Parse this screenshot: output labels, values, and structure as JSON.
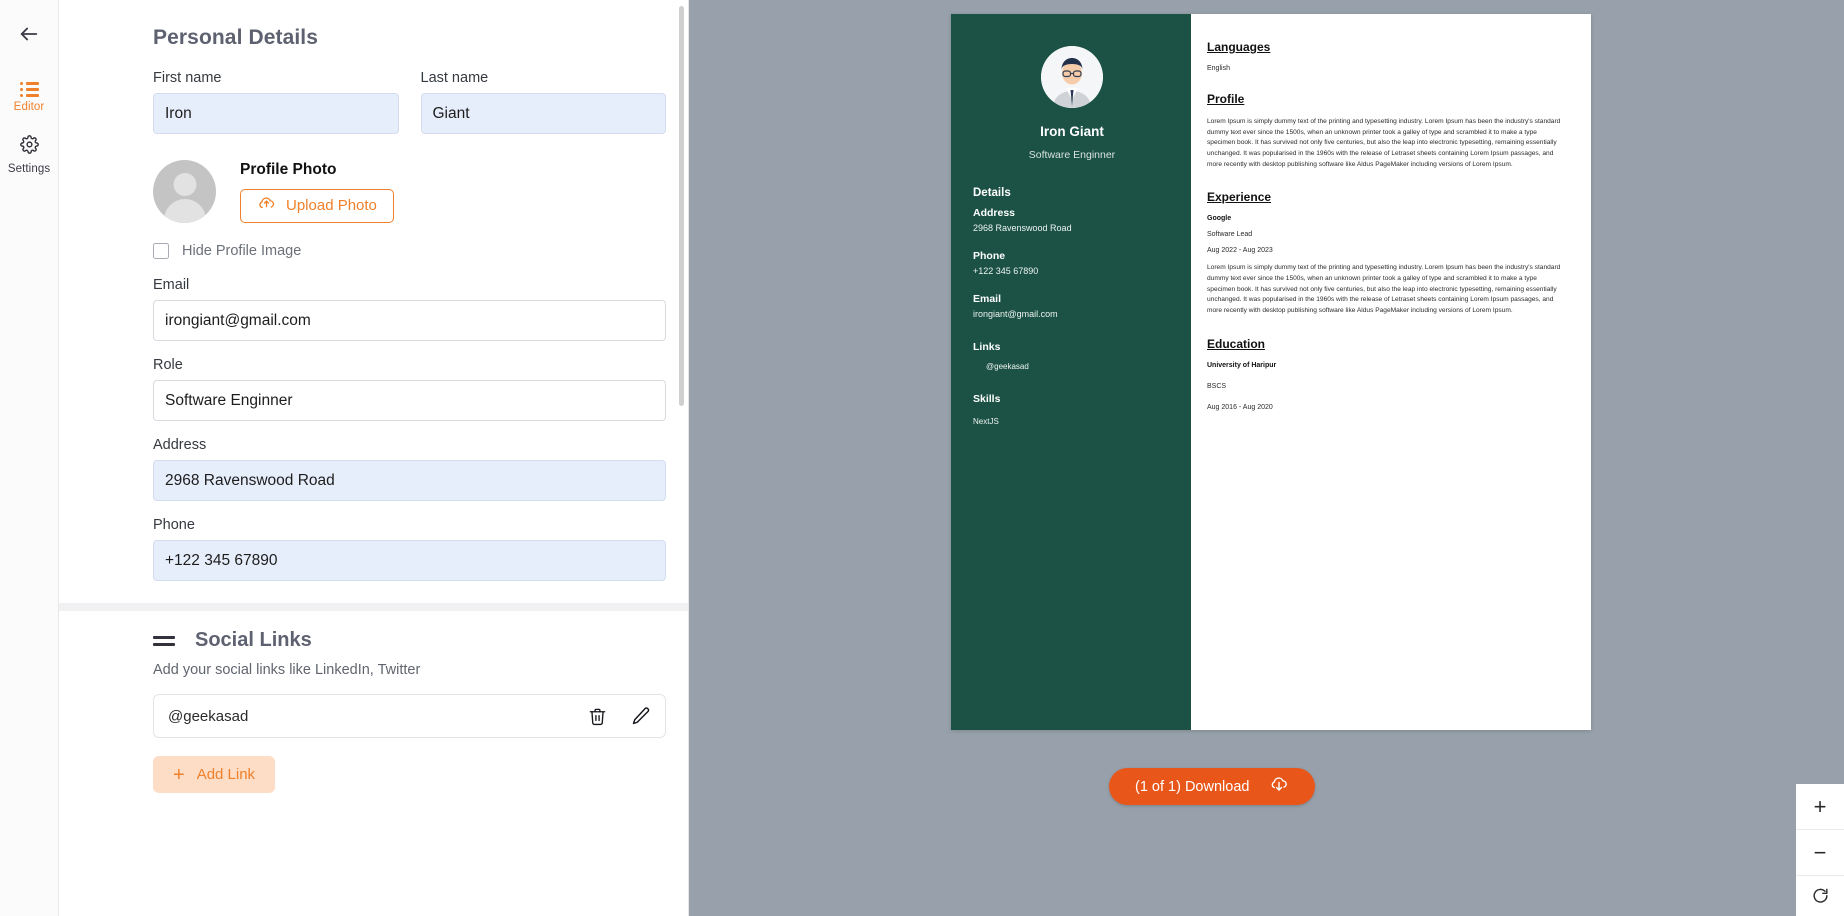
{
  "rail": {
    "back_icon": "back-arrow-icon",
    "items": [
      {
        "label": "Editor",
        "icon": "list-icon",
        "active": true
      },
      {
        "label": "Settings",
        "icon": "gear-icon",
        "active": false
      }
    ]
  },
  "form": {
    "section_title": "Personal Details",
    "first_name": {
      "label": "First name",
      "value": "Iron"
    },
    "last_name": {
      "label": "Last name",
      "value": "Giant"
    },
    "profile_photo": {
      "title": "Profile Photo",
      "upload_label": "Upload Photo",
      "upload_icon": "cloud-upload-icon"
    },
    "hide_profile_image": {
      "label": "Hide Profile Image",
      "checked": false
    },
    "email": {
      "label": "Email",
      "value": "irongiant@gmail.com"
    },
    "role": {
      "label": "Role",
      "value": "Software Enginner"
    },
    "address": {
      "label": "Address",
      "value": "2968 Ravenswood Road"
    },
    "phone": {
      "label": "Phone",
      "value": "+122 345 67890"
    },
    "social": {
      "title": "Social Links",
      "subtitle": "Add your social links like LinkedIn, Twitter",
      "links": [
        {
          "value": "@geekasad"
        }
      ],
      "delete_icon": "trash-icon",
      "edit_icon": "pencil-icon",
      "add_label": "Add Link",
      "add_icon": "plus-icon"
    }
  },
  "preview": {
    "cv": {
      "name": "Iron Giant",
      "role": "Software Enginner",
      "details_heading": "Details",
      "address_label": "Address",
      "address_value": "2968 Ravenswood Road",
      "phone_label": "Phone",
      "phone_value": "+122 345 67890",
      "email_label": "Email",
      "email_value": "irongiant@gmail.com",
      "links_label": "Links",
      "links_value": "@geekasad",
      "skills_label": "Skills",
      "skills_value": "NextJS",
      "languages_heading": "Languages",
      "languages_value": "English",
      "profile_heading": "Profile",
      "profile_text": "Lorem Ipsum is simply dummy text of the printing and typesetting industry. Lorem Ipsum has been the industry's standard dummy text ever since the 1500s, when an unknown printer took a galley of type and scrambled it to make a type specimen book. It has survived not only five centuries, but also the leap into electronic typesetting, remaining essentially unchanged. It was popularised in the 1960s with the release of Letraset sheets containing Lorem Ipsum passages, and more recently with desktop publishing software like Aldus PageMaker including versions of Lorem Ipsum.",
      "experience_heading": "Experience",
      "experience_company": "Google",
      "experience_title": "Software Lead",
      "experience_dates": "Aug 2022 - Aug 2023",
      "experience_text": "Lorem Ipsum is simply dummy text of the printing and typesetting industry. Lorem Ipsum has been the industry's standard dummy text ever since the 1500s, when an unknown printer took a galley of type and scrambled it to make a type specimen book. It has survived not only five centuries, but also the leap into electronic typesetting, remaining essentially unchanged. It was popularised in the 1960s with the release of Letraset sheets containing Lorem Ipsum passages, and more recently with desktop publishing software like Aldus PageMaker including versions of Lorem Ipsum.",
      "education_heading": "Education",
      "education_school": "University of Haripur",
      "education_degree": "BSCS",
      "education_dates": "Aug 2016 - Aug 2020"
    },
    "download_label": "(1 of 1) Download",
    "download_icon": "cloud-download-icon",
    "zoom_in": "+",
    "zoom_out": "−",
    "reset_icon": "rotate-icon"
  },
  "colors": {
    "accent": "#f0802a",
    "download": "#e8561a",
    "cv_sidebar": "#1b5245",
    "field_filled": "#e7eefb",
    "preview_bg": "#98a1ab"
  }
}
